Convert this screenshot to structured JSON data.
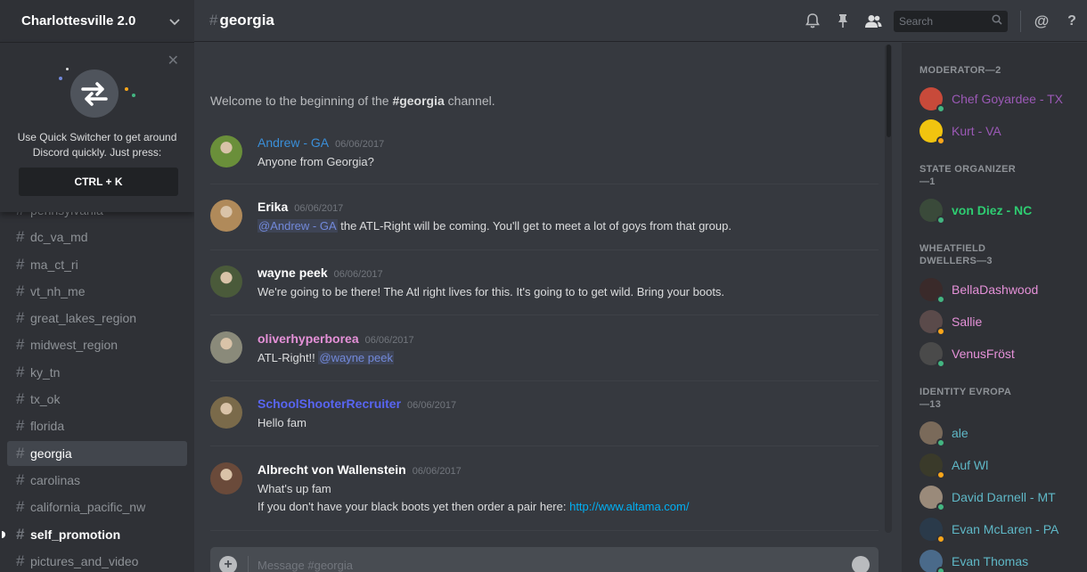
{
  "server": {
    "name": "Charlottesville 2.0"
  },
  "quick_switcher": {
    "text": "Use Quick Switcher to get around Discord quickly. Just press:",
    "shortcut": "CTRL + K"
  },
  "channels": [
    {
      "name": "pennsylvania",
      "state": "normal"
    },
    {
      "name": "dc_va_md",
      "state": "normal"
    },
    {
      "name": "ma_ct_ri",
      "state": "normal"
    },
    {
      "name": "vt_nh_me",
      "state": "normal"
    },
    {
      "name": "great_lakes_region",
      "state": "normal"
    },
    {
      "name": "midwest_region",
      "state": "normal"
    },
    {
      "name": "ky_tn",
      "state": "normal"
    },
    {
      "name": "tx_ok",
      "state": "normal"
    },
    {
      "name": "florida",
      "state": "normal"
    },
    {
      "name": "georgia",
      "state": "active"
    },
    {
      "name": "carolinas",
      "state": "normal"
    },
    {
      "name": "california_pacific_nw",
      "state": "normal"
    },
    {
      "name": "self_promotion",
      "state": "unread"
    },
    {
      "name": "pictures_and_video",
      "state": "normal"
    }
  ],
  "header": {
    "channel": "georgia",
    "search_placeholder": "Search",
    "icons": [
      "bell-icon",
      "pin-icon",
      "members-icon",
      "search-icon",
      "at-icon",
      "help-icon"
    ]
  },
  "welcome": {
    "prefix": "Welcome to the beginning of the ",
    "channel": "#georgia",
    "suffix": " channel."
  },
  "messages": [
    {
      "author": "Andrew - GA",
      "color": "#3a8fd9",
      "timestamp": "06/06/2017",
      "text": "Anyone from Georgia?",
      "avatar": "#6a8f3a"
    },
    {
      "author": "Erika",
      "color": "#ffffff",
      "timestamp": "06/06/2017",
      "mention": "@Andrew - GA",
      "text": " the ATL-Right will be coming. You'll get to meet a lot of goys from that group.",
      "avatar": "#b08a5a"
    },
    {
      "author": "wayne peek",
      "color": "#ffffff",
      "timestamp": "06/06/2017",
      "text": "We're going to be there! The Atl right lives for this. It's going to to get wild. Bring your boots.",
      "avatar": "#4a5a3a"
    },
    {
      "author": "oliverhyperborea",
      "color": "#e591d8",
      "timestamp": "06/06/2017",
      "text": "ATL-Right!! ",
      "mention_after": "@wayne peek",
      "avatar": "#8a8a7a"
    },
    {
      "author": "SchoolShooterRecruiter",
      "color": "#5865f2",
      "timestamp": "06/06/2017",
      "text": "Hello fam",
      "avatar": "#7a6a4a"
    },
    {
      "author": "Albrecht von Wallenstein",
      "color": "#ffffff",
      "timestamp": "06/06/2017",
      "text": "What's up fam",
      "text2": "If you don't have your black boots yet then order a pair here: ",
      "link": "http://www.altama.com/",
      "avatar": "#6a4a3a"
    }
  ],
  "input": {
    "placeholder": "Message #georgia"
  },
  "member_groups": [
    {
      "role": "MODERATOR—2",
      "members": [
        {
          "name": "Chef Goyardee - TX",
          "color": "#9b59b6",
          "status": "#43b581",
          "avatar": "#c84a3a"
        },
        {
          "name": "Kurt - VA",
          "color": "#9b59b6",
          "status": "#faa61a",
          "avatar": "#f1c40f"
        }
      ]
    },
    {
      "role": "STATE ORGANIZER—1",
      "members": [
        {
          "name": "von Diez - NC",
          "color": "#2ecc71",
          "status": "#43b581",
          "avatar": "#3a4a3a",
          "bold": true
        }
      ]
    },
    {
      "role": "WHEATFIELD DWELLERS—3",
      "members": [
        {
          "name": "BellaDashwood",
          "color": "#e591d8",
          "status": "#43b581",
          "avatar": "#3a2a2a"
        },
        {
          "name": "Sallie",
          "color": "#e591d8",
          "status": "#faa61a",
          "avatar": "#5a4a4a"
        },
        {
          "name": "VenusFröst",
          "color": "#e591d8",
          "status": "#43b581",
          "avatar": "#4a4a4a"
        }
      ]
    },
    {
      "role": "IDENTITY EVROPA—13",
      "members": [
        {
          "name": "ale",
          "color": "#5fb8c7",
          "status": "#43b581",
          "avatar": "#7a6a5a"
        },
        {
          "name": "Auf Wl",
          "color": "#5fb8c7",
          "status": "#faa61a",
          "avatar": "#3a3a2a"
        },
        {
          "name": "David Darnell - MT",
          "color": "#5fb8c7",
          "status": "#43b581",
          "avatar": "#9a8a7a"
        },
        {
          "name": "Evan McLaren - PA",
          "color": "#5fb8c7",
          "status": "#faa61a",
          "avatar": "#2a3a4a"
        },
        {
          "name": "Evan Thomas",
          "color": "#5fb8c7",
          "status": "#43b581",
          "avatar": "#4a6a8a"
        }
      ]
    }
  ]
}
